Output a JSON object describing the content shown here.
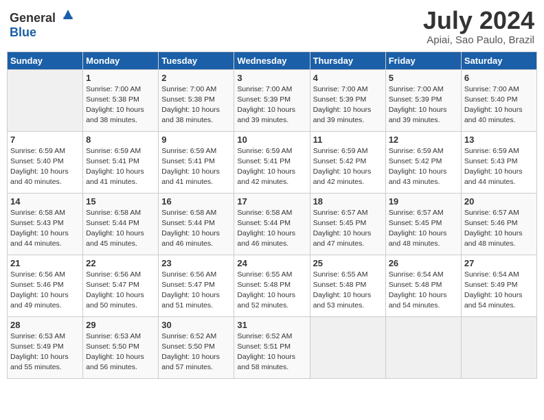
{
  "header": {
    "logo_general": "General",
    "logo_blue": "Blue",
    "month_year": "July 2024",
    "location": "Apiai, Sao Paulo, Brazil"
  },
  "days_of_week": [
    "Sunday",
    "Monday",
    "Tuesday",
    "Wednesday",
    "Thursday",
    "Friday",
    "Saturday"
  ],
  "weeks": [
    [
      {
        "day": "",
        "info": ""
      },
      {
        "day": "1",
        "info": "Sunrise: 7:00 AM\nSunset: 5:38 PM\nDaylight: 10 hours\nand 38 minutes."
      },
      {
        "day": "2",
        "info": "Sunrise: 7:00 AM\nSunset: 5:38 PM\nDaylight: 10 hours\nand 38 minutes."
      },
      {
        "day": "3",
        "info": "Sunrise: 7:00 AM\nSunset: 5:39 PM\nDaylight: 10 hours\nand 39 minutes."
      },
      {
        "day": "4",
        "info": "Sunrise: 7:00 AM\nSunset: 5:39 PM\nDaylight: 10 hours\nand 39 minutes."
      },
      {
        "day": "5",
        "info": "Sunrise: 7:00 AM\nSunset: 5:39 PM\nDaylight: 10 hours\nand 39 minutes."
      },
      {
        "day": "6",
        "info": "Sunrise: 7:00 AM\nSunset: 5:40 PM\nDaylight: 10 hours\nand 40 minutes."
      }
    ],
    [
      {
        "day": "7",
        "info": "Sunrise: 6:59 AM\nSunset: 5:40 PM\nDaylight: 10 hours\nand 40 minutes."
      },
      {
        "day": "8",
        "info": "Sunrise: 6:59 AM\nSunset: 5:41 PM\nDaylight: 10 hours\nand 41 minutes."
      },
      {
        "day": "9",
        "info": "Sunrise: 6:59 AM\nSunset: 5:41 PM\nDaylight: 10 hours\nand 41 minutes."
      },
      {
        "day": "10",
        "info": "Sunrise: 6:59 AM\nSunset: 5:41 PM\nDaylight: 10 hours\nand 42 minutes."
      },
      {
        "day": "11",
        "info": "Sunrise: 6:59 AM\nSunset: 5:42 PM\nDaylight: 10 hours\nand 42 minutes."
      },
      {
        "day": "12",
        "info": "Sunrise: 6:59 AM\nSunset: 5:42 PM\nDaylight: 10 hours\nand 43 minutes."
      },
      {
        "day": "13",
        "info": "Sunrise: 6:59 AM\nSunset: 5:43 PM\nDaylight: 10 hours\nand 44 minutes."
      }
    ],
    [
      {
        "day": "14",
        "info": "Sunrise: 6:58 AM\nSunset: 5:43 PM\nDaylight: 10 hours\nand 44 minutes."
      },
      {
        "day": "15",
        "info": "Sunrise: 6:58 AM\nSunset: 5:44 PM\nDaylight: 10 hours\nand 45 minutes."
      },
      {
        "day": "16",
        "info": "Sunrise: 6:58 AM\nSunset: 5:44 PM\nDaylight: 10 hours\nand 46 minutes."
      },
      {
        "day": "17",
        "info": "Sunrise: 6:58 AM\nSunset: 5:44 PM\nDaylight: 10 hours\nand 46 minutes."
      },
      {
        "day": "18",
        "info": "Sunrise: 6:57 AM\nSunset: 5:45 PM\nDaylight: 10 hours\nand 47 minutes."
      },
      {
        "day": "19",
        "info": "Sunrise: 6:57 AM\nSunset: 5:45 PM\nDaylight: 10 hours\nand 48 minutes."
      },
      {
        "day": "20",
        "info": "Sunrise: 6:57 AM\nSunset: 5:46 PM\nDaylight: 10 hours\nand 48 minutes."
      }
    ],
    [
      {
        "day": "21",
        "info": "Sunrise: 6:56 AM\nSunset: 5:46 PM\nDaylight: 10 hours\nand 49 minutes."
      },
      {
        "day": "22",
        "info": "Sunrise: 6:56 AM\nSunset: 5:47 PM\nDaylight: 10 hours\nand 50 minutes."
      },
      {
        "day": "23",
        "info": "Sunrise: 6:56 AM\nSunset: 5:47 PM\nDaylight: 10 hours\nand 51 minutes."
      },
      {
        "day": "24",
        "info": "Sunrise: 6:55 AM\nSunset: 5:48 PM\nDaylight: 10 hours\nand 52 minutes."
      },
      {
        "day": "25",
        "info": "Sunrise: 6:55 AM\nSunset: 5:48 PM\nDaylight: 10 hours\nand 53 minutes."
      },
      {
        "day": "26",
        "info": "Sunrise: 6:54 AM\nSunset: 5:48 PM\nDaylight: 10 hours\nand 54 minutes."
      },
      {
        "day": "27",
        "info": "Sunrise: 6:54 AM\nSunset: 5:49 PM\nDaylight: 10 hours\nand 54 minutes."
      }
    ],
    [
      {
        "day": "28",
        "info": "Sunrise: 6:53 AM\nSunset: 5:49 PM\nDaylight: 10 hours\nand 55 minutes."
      },
      {
        "day": "29",
        "info": "Sunrise: 6:53 AM\nSunset: 5:50 PM\nDaylight: 10 hours\nand 56 minutes."
      },
      {
        "day": "30",
        "info": "Sunrise: 6:52 AM\nSunset: 5:50 PM\nDaylight: 10 hours\nand 57 minutes."
      },
      {
        "day": "31",
        "info": "Sunrise: 6:52 AM\nSunset: 5:51 PM\nDaylight: 10 hours\nand 58 minutes."
      },
      {
        "day": "",
        "info": ""
      },
      {
        "day": "",
        "info": ""
      },
      {
        "day": "",
        "info": ""
      }
    ]
  ]
}
